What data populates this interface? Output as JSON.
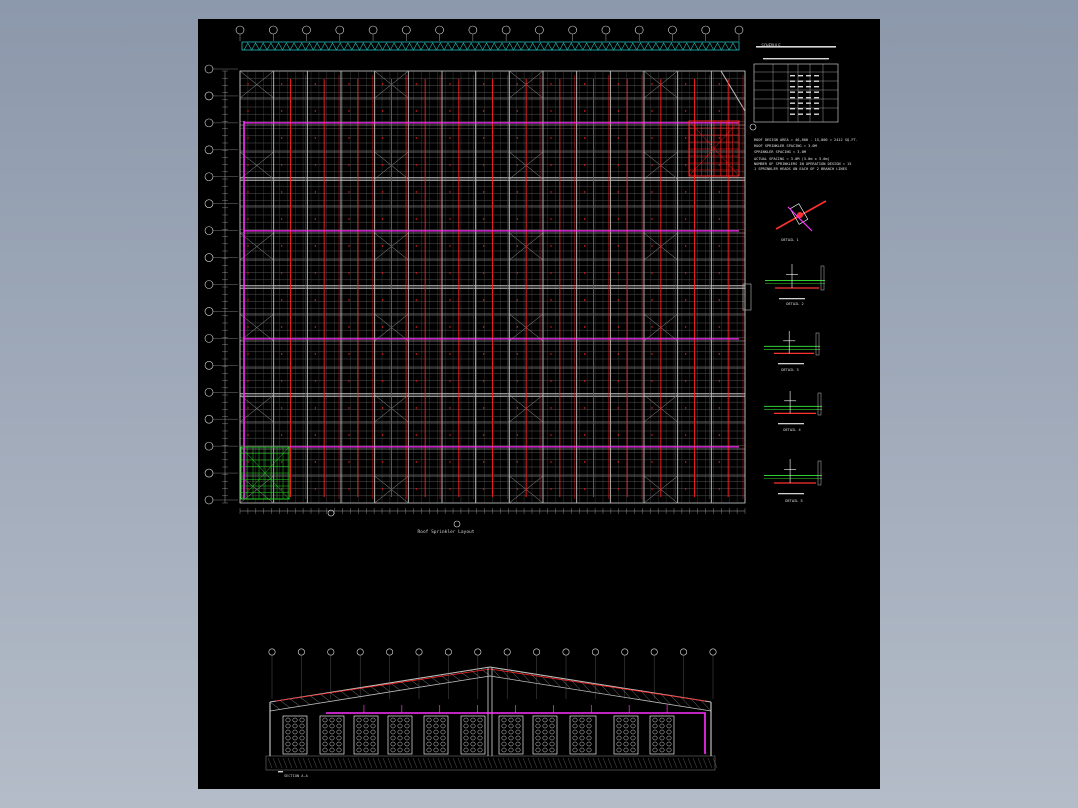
{
  "colors": {
    "background": "#000000",
    "structure": "#bfbfbf",
    "sprinkler_branch": "#ff2020",
    "main_pipe": "#ff30ff",
    "header_band": "#22c0c0",
    "riser_zone_top": "#ff2020",
    "riser_zone_bottom": "#20d020",
    "dimension": "#d0d0d0"
  },
  "plan": {
    "column_grid_count": 16,
    "row_grid_count": 17,
    "title": "Roof Sprinkler Layout"
  },
  "notes": {
    "table_title": "SCHEDULE",
    "lines": [
      "ROOF DESIGN AREA = 46,800 - 15,000 = 2412 SQ.FT.",
      "ROOF SPRINKLER SPACING = 3.0M",
      "SPRINKLER SPACING = 3.0M",
      "ACTUAL SPACING = 3.0M (3.0m x 3.0m)",
      "NUMBER OF SPRINKLERS IN OPERATION DESIGN = 15",
      "1 SPRINKLER HEADS ON EACH OF 2 BRANCH LINES"
    ]
  },
  "details": [
    {
      "id": "detail-1",
      "caption": "DETAIL 1"
    },
    {
      "id": "detail-2",
      "caption": "DETAIL 2"
    },
    {
      "id": "detail-3",
      "caption": "DETAIL 3"
    },
    {
      "id": "detail-4",
      "caption": "DETAIL 4"
    },
    {
      "id": "detail-5",
      "caption": "DETAIL 5"
    }
  ],
  "section": {
    "bay_count": 16,
    "title": "SECTION A-A"
  }
}
